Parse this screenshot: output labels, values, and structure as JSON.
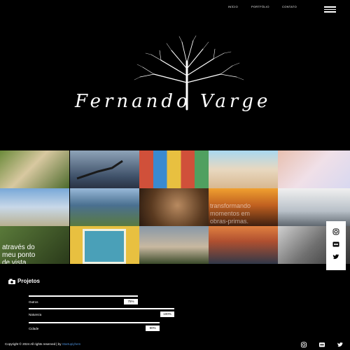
{
  "nav": {
    "items": [
      {
        "label": "INÍCIO"
      },
      {
        "label": "PORTFÓLIO"
      },
      {
        "label": "CONTATO"
      }
    ]
  },
  "logo": {
    "text": "Fernando Varge"
  },
  "gallery": {
    "overlays": {
      "tile_r1c3": "transformando\nmomentos em\nobras-primas.",
      "tile_r2c0": "através do\nmeu ponto\nde vista."
    }
  },
  "projects": {
    "title": "Projetos",
    "items": [
      {
        "label": "Outros",
        "percent_label": "75%",
        "percent": 75
      },
      {
        "label": "Natureza",
        "percent_label": "100%",
        "percent": 100
      },
      {
        "label": "Cidade",
        "percent_label": "90%",
        "percent": 90
      }
    ]
  },
  "footer": {
    "copyright": "Copyright © 2024 All rights reserved | by",
    "link": "Startupiyhem"
  },
  "icons": {
    "side": [
      "instagram-icon",
      "flickr-icon",
      "twitter-icon"
    ],
    "footer": [
      "instagram-icon",
      "flickr-icon",
      "twitter-icon"
    ]
  }
}
